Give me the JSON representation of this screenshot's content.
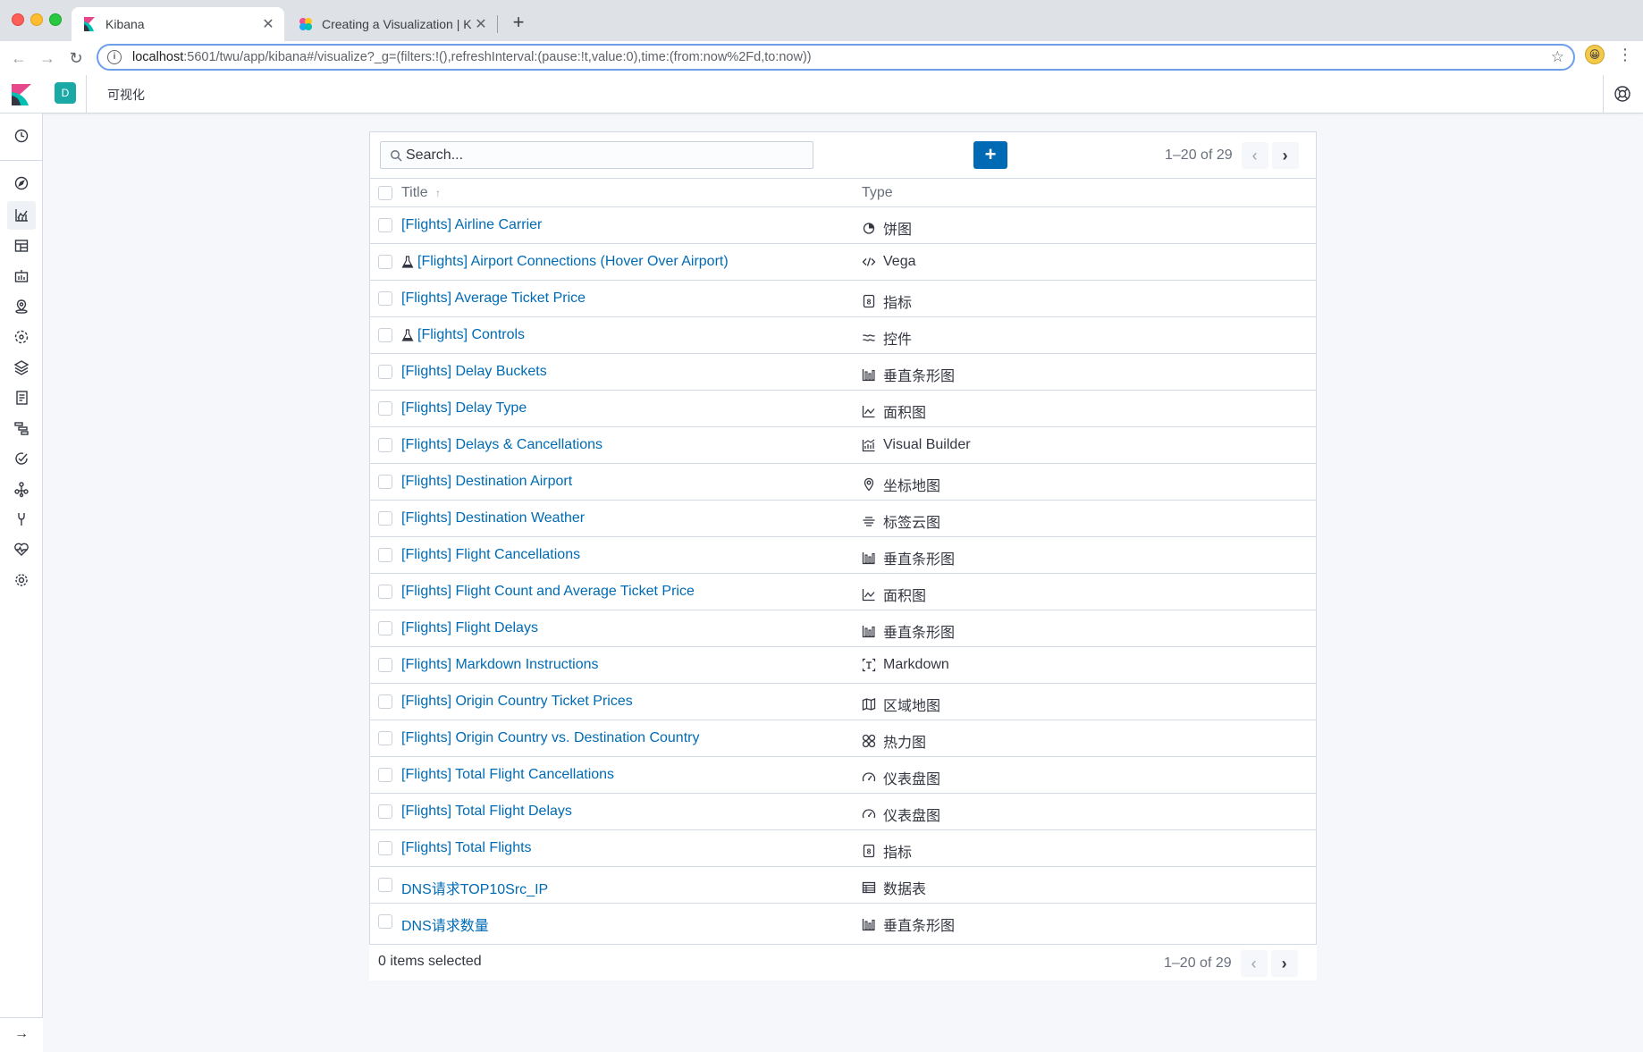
{
  "browser": {
    "tabs": [
      {
        "title": "Kibana",
        "active": true
      },
      {
        "title": "Creating a Visualization | Kiban",
        "active": false
      }
    ],
    "url_host": "localhost",
    "url_path": ":5601/twu/app/kibana#/visualize?_g=(filters:!(),refreshInterval:(pause:!t,value:0),time:(from:now%2Fd,to:now))"
  },
  "header": {
    "space_initial": "D",
    "breadcrumb": "可视化"
  },
  "colors": {
    "link": "#006bb4",
    "accent": "#1ba9a5",
    "primary_button": "#006bb4"
  },
  "nav": {
    "icons": [
      "clock-icon",
      "discover-icon",
      "visualize-icon",
      "dashboard-icon",
      "canvas-icon",
      "maps-icon",
      "ml-icon",
      "infrastructure-icon",
      "logs-icon",
      "apm-icon",
      "uptime-icon",
      "graph-icon",
      "dev-tools-icon",
      "monitoring-icon",
      "management-icon"
    ],
    "collapse_icon": "arrow-right-icon"
  },
  "toolbar": {
    "search_placeholder": "Search...",
    "create_label": "+",
    "range": "1–20 of 29"
  },
  "table": {
    "col_title": "Title",
    "col_type": "Type",
    "rows": [
      {
        "title": "[Flights] Airline Carrier",
        "experimental": false,
        "type": "饼图",
        "icon": "pie-icon"
      },
      {
        "title": "[Flights] Airport Connections (Hover Over Airport)",
        "experimental": true,
        "type": "Vega",
        "icon": "code-icon"
      },
      {
        "title": "[Flights] Average Ticket Price",
        "experimental": false,
        "type": "指标",
        "icon": "metric-icon"
      },
      {
        "title": "[Flights] Controls",
        "experimental": true,
        "type": "控件",
        "icon": "controls-icon"
      },
      {
        "title": "[Flights] Delay Buckets",
        "experimental": false,
        "type": "垂直条形图",
        "icon": "bar-chart-icon"
      },
      {
        "title": "[Flights] Delay Type",
        "experimental": false,
        "type": "面积图",
        "icon": "area-chart-icon"
      },
      {
        "title": "[Flights] Delays & Cancellations",
        "experimental": false,
        "type": "Visual Builder",
        "icon": "visual-builder-icon"
      },
      {
        "title": "[Flights] Destination Airport",
        "experimental": false,
        "type": "坐标地图",
        "icon": "map-pin-icon"
      },
      {
        "title": "[Flights] Destination Weather",
        "experimental": false,
        "type": "标签云图",
        "icon": "tag-cloud-icon"
      },
      {
        "title": "[Flights] Flight Cancellations",
        "experimental": false,
        "type": "垂直条形图",
        "icon": "bar-chart-icon"
      },
      {
        "title": "[Flights] Flight Count and Average Ticket Price",
        "experimental": false,
        "type": "面积图",
        "icon": "area-chart-icon"
      },
      {
        "title": "[Flights] Flight Delays",
        "experimental": false,
        "type": "垂直条形图",
        "icon": "bar-chart-icon"
      },
      {
        "title": "[Flights] Markdown Instructions",
        "experimental": false,
        "type": "Markdown",
        "icon": "markdown-icon"
      },
      {
        "title": "[Flights] Origin Country Ticket Prices",
        "experimental": false,
        "type": "区域地图",
        "icon": "region-map-icon"
      },
      {
        "title": "[Flights] Origin Country vs. Destination Country",
        "experimental": false,
        "type": "热力图",
        "icon": "heatmap-icon"
      },
      {
        "title": "[Flights] Total Flight Cancellations",
        "experimental": false,
        "type": "仪表盘图",
        "icon": "gauge-icon"
      },
      {
        "title": "[Flights] Total Flight Delays",
        "experimental": false,
        "type": "仪表盘图",
        "icon": "gauge-icon"
      },
      {
        "title": "[Flights] Total Flights",
        "experimental": false,
        "type": "指标",
        "icon": "metric-icon"
      },
      {
        "title": "DNS请求TOP10Src_IP",
        "experimental": false,
        "type": "数据表",
        "icon": "table-icon"
      },
      {
        "title": "DNS请求数量",
        "experimental": false,
        "type": "垂直条形图",
        "icon": "bar-chart-icon"
      }
    ]
  },
  "footer": {
    "selected": "0 items selected",
    "range": "1–20 of 29"
  }
}
